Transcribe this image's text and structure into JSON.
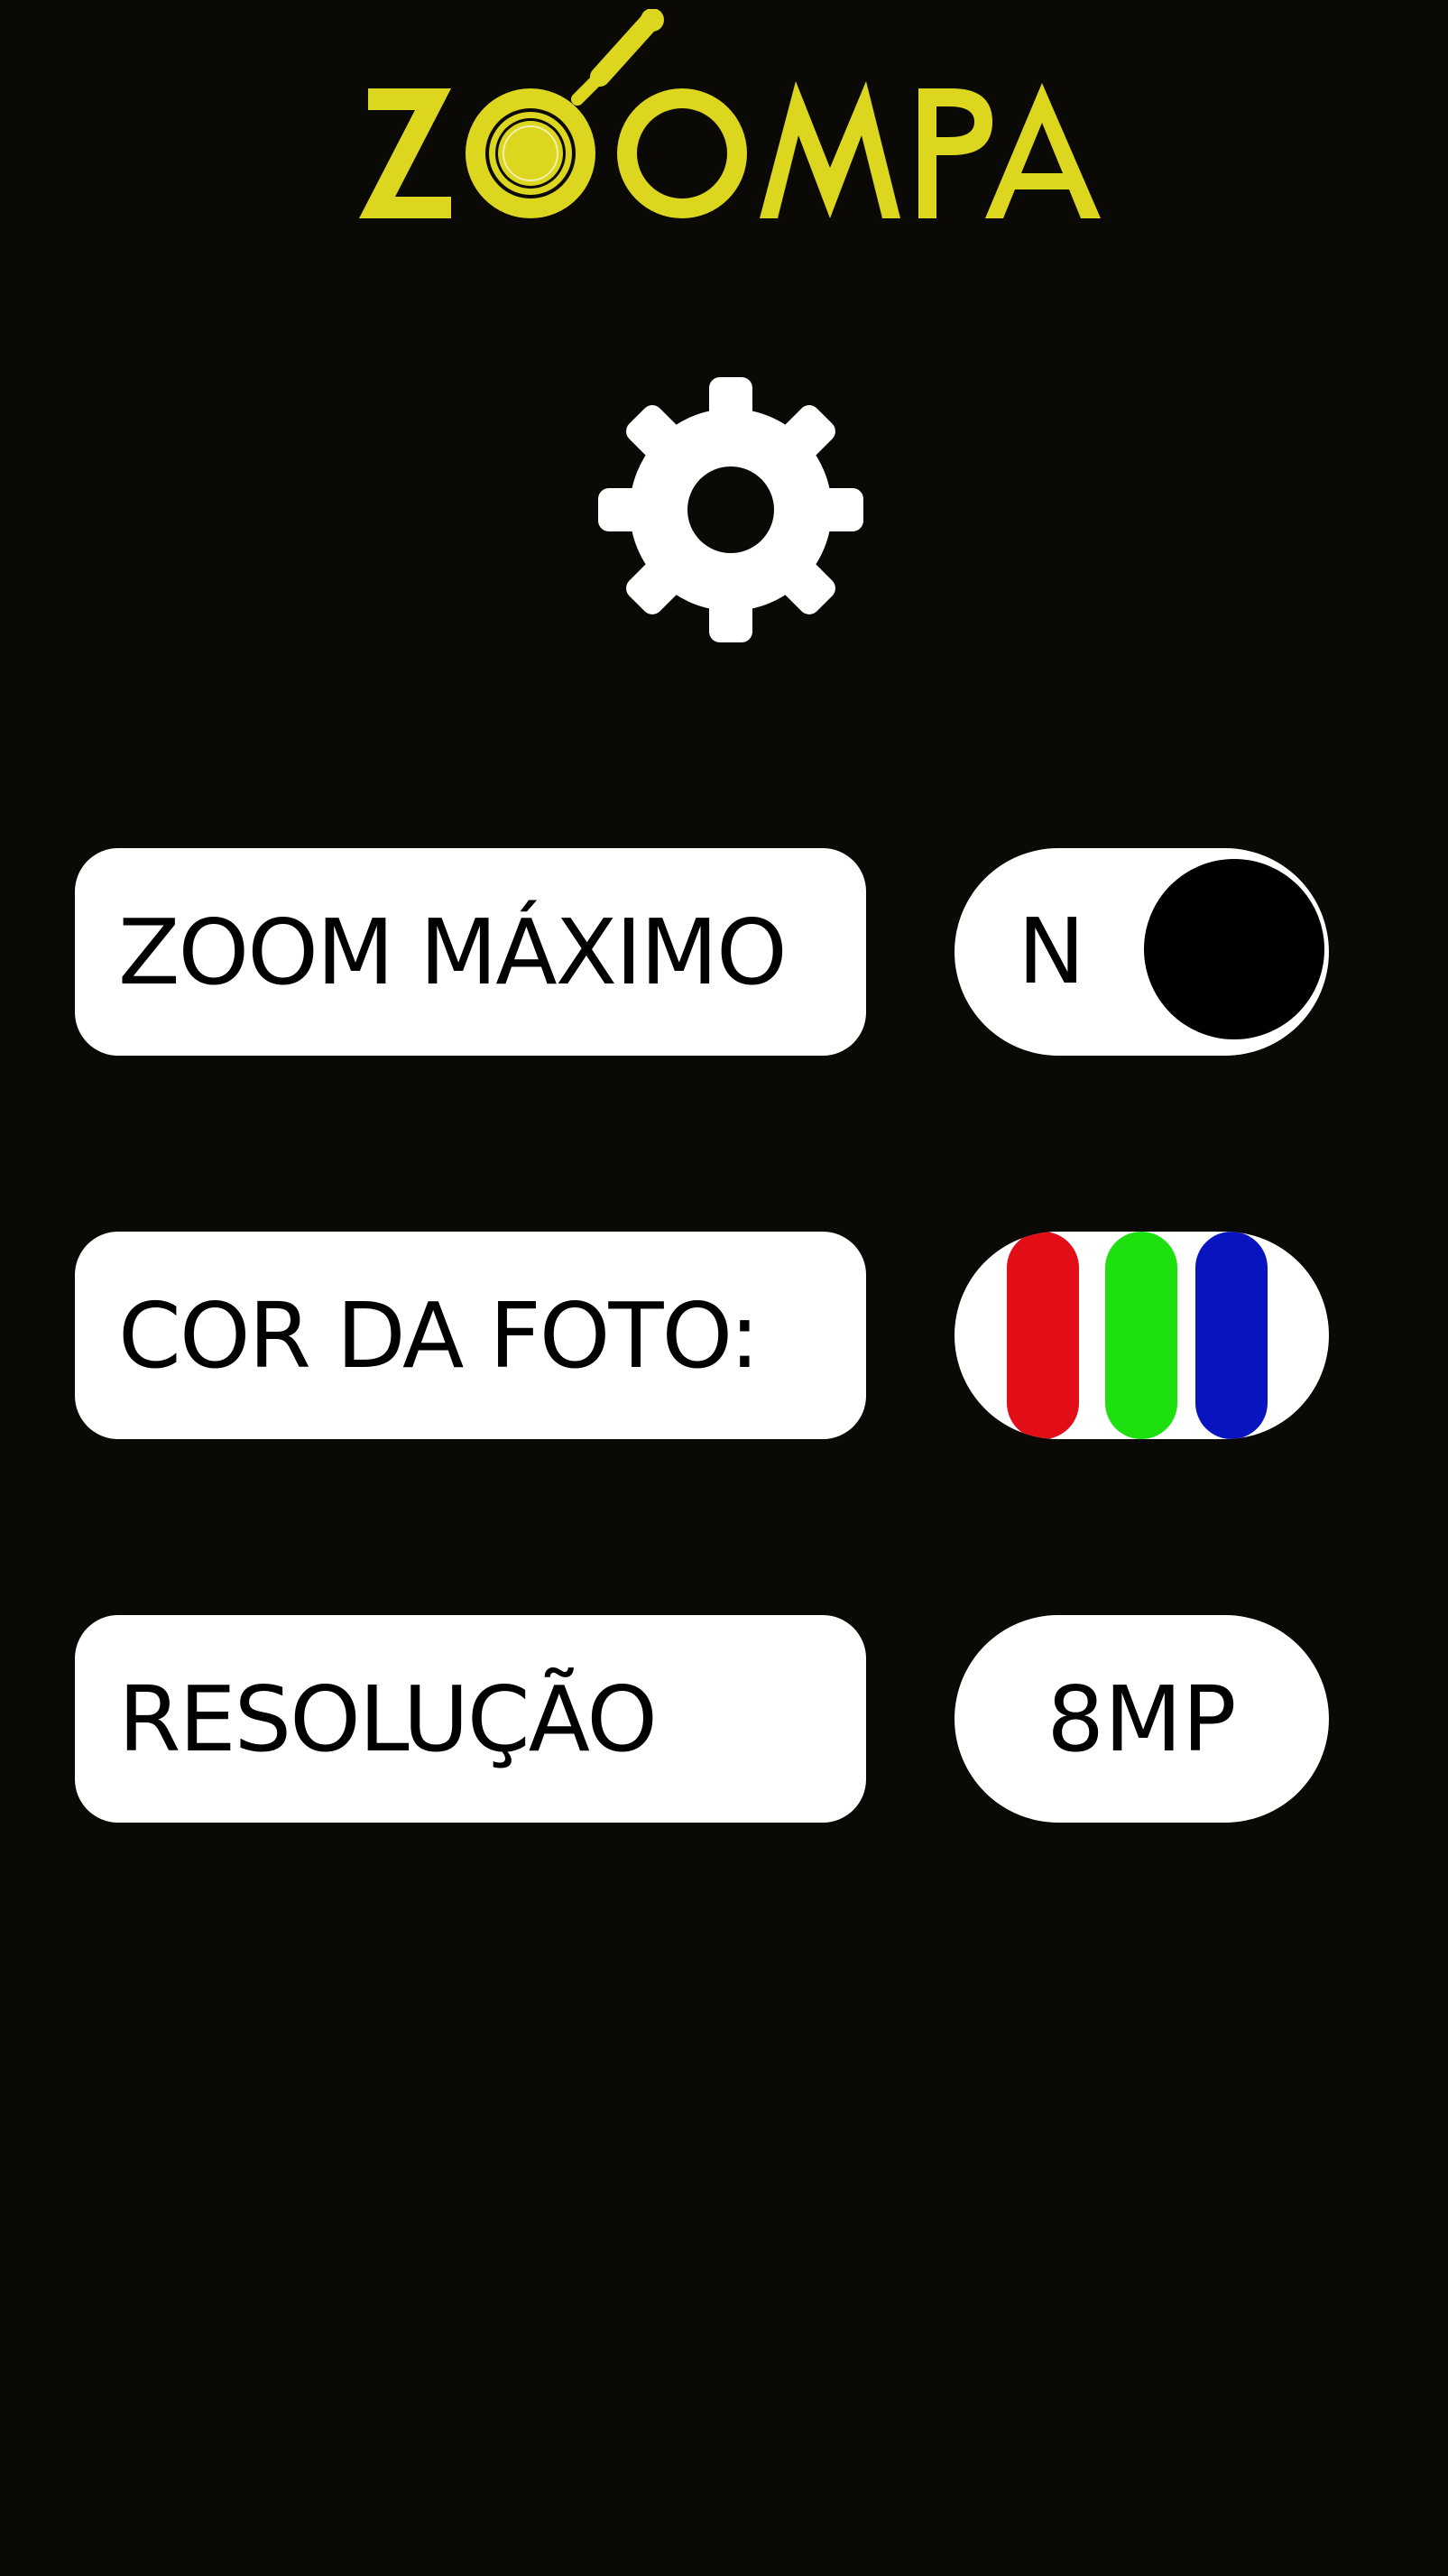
{
  "app": {
    "logo_text": "ZOOMPA"
  },
  "colors": {
    "background": "#0a0905",
    "logo": "#dcd61e",
    "panel": "#ffffff",
    "text": "#000000",
    "swatch_red": "#e30d18",
    "swatch_green": "#1fe00f",
    "swatch_blue": "#0814bf"
  },
  "settings_icon": "gear-icon",
  "settings": {
    "zoom": {
      "label": "ZOOM MÁXIMO",
      "toggle_value": "N",
      "enabled": false
    },
    "color": {
      "label": "COR DA FOTO:",
      "swatches": [
        "red",
        "green",
        "blue"
      ]
    },
    "resolution": {
      "label": "RESOLUÇÃO",
      "value": "8MP"
    }
  }
}
